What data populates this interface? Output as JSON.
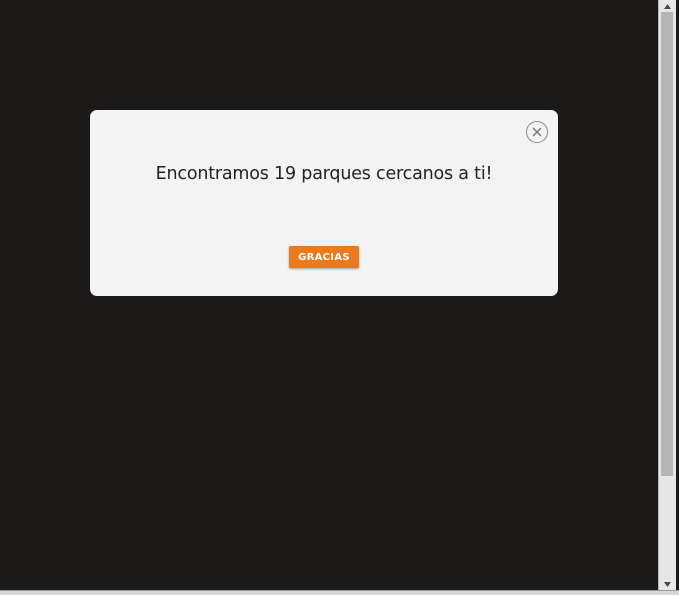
{
  "modal": {
    "message": "Encontramos 19 parques cercanos a ti!",
    "confirm_label": "GRACIAS",
    "close_icon": "close-icon"
  },
  "colors": {
    "backdrop": "#1b1a19",
    "modal_bg": "#f3f3f3",
    "accent": "#ea7a1c"
  }
}
